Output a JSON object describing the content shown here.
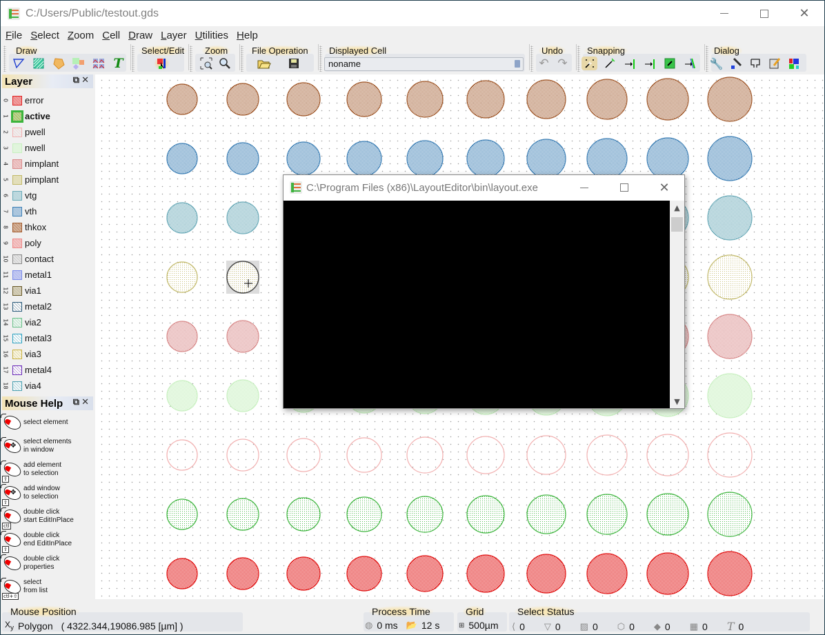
{
  "window": {
    "title": "C:/Users/Public/testout.gds",
    "controls": {
      "minimize": "minimize",
      "maximize": "maximize",
      "close": "close"
    }
  },
  "menu": [
    {
      "label": "File",
      "accel": "F",
      "rest": "ile"
    },
    {
      "label": "Select",
      "accel": "S",
      "rest": "elect"
    },
    {
      "label": "Zoom",
      "accel": "Z",
      "rest": "oom"
    },
    {
      "label": "Cell",
      "accel": "C",
      "rest": "ell"
    },
    {
      "label": "Draw",
      "accel": "D",
      "rest": "raw"
    },
    {
      "label": "Layer",
      "accel": "L",
      "rest": "ayer"
    },
    {
      "label": "Utilities",
      "accel": "U",
      "rest": "tilities"
    },
    {
      "label": "Help",
      "accel": "H",
      "rest": "elp"
    }
  ],
  "toolbar": {
    "draw": {
      "label": "Draw",
      "icons": [
        "draw-path-icon",
        "draw-box-icon",
        "draw-polygon-icon",
        "draw-boolean-icon",
        "draw-cell-array-icon",
        "draw-text-icon"
      ]
    },
    "select_edit": {
      "label": "Select/Edit",
      "icons": [
        "select-edit-icon"
      ]
    },
    "zoom": {
      "label": "Zoom",
      "icons": [
        "zoom-fit-icon",
        "zoom-magnifier-icon"
      ]
    },
    "file_operation": {
      "label": "File Operation",
      "icons": [
        "open-folder-icon",
        "save-disk-icon"
      ]
    },
    "displayed_cell": {
      "label": "Displayed Cell",
      "value": "noname"
    },
    "undo": {
      "label": "Undo",
      "icons": [
        "undo-icon",
        "redo-icon"
      ]
    },
    "snapping": {
      "label": "Snapping",
      "icons": [
        "snap-grid-icon",
        "snap-point-icon",
        "snap-edge-icon",
        "snap-middle-icon",
        "snap-element-icon",
        "snap-angle-icon"
      ]
    },
    "dialog": {
      "label": "Dialog",
      "icons": [
        "setup-icon",
        "macro-setup-icon",
        "schematic-icon",
        "properties-note-icon",
        "layer-colors-icon"
      ]
    }
  },
  "layer_panel": {
    "title": "Layer",
    "layers": [
      {
        "num": "0",
        "name": "error",
        "color": "#e02020",
        "fill": "#f08a8a",
        "active": false
      },
      {
        "num": "1",
        "name": "active",
        "color": "#3cb43c",
        "fill": "#b6c46a",
        "active": true
      },
      {
        "num": "2",
        "name": "pwell",
        "color": "#f2b0b0",
        "fill": "#eeeeee",
        "active": false
      },
      {
        "num": "3",
        "name": "nwell",
        "color": "#c8f0c0",
        "fill": "#dff7da",
        "active": false
      },
      {
        "num": "4",
        "name": "nimplant",
        "color": "#d88a8a",
        "fill": "#edb8b8",
        "active": false
      },
      {
        "num": "5",
        "name": "pimplant",
        "color": "#c2b96a",
        "fill": "#e4dfb4",
        "active": false
      },
      {
        "num": "6",
        "name": "vtg",
        "color": "#6aaab8",
        "fill": "#b9d8de",
        "active": false
      },
      {
        "num": "7",
        "name": "vth",
        "color": "#3d7fb5",
        "fill": "#a7c4de",
        "active": false
      },
      {
        "num": "8",
        "name": "thkox",
        "color": "#a0582a",
        "fill": "#c99a78",
        "active": false
      },
      {
        "num": "9",
        "name": "poly",
        "color": "#ee8888",
        "fill": "#f2b4b4",
        "active": false
      },
      {
        "num": "10",
        "name": "contact",
        "color": "#8a8a8a",
        "fill": "#e6e6e6",
        "active": false
      },
      {
        "num": "11",
        "name": "metal1",
        "color": "#7a8ae8",
        "fill": "#b7bff2",
        "active": false
      },
      {
        "num": "12",
        "name": "via1",
        "color": "#6a5a2a",
        "fill": "#d6cfb4",
        "active": false
      },
      {
        "num": "13",
        "name": "metal2",
        "color": "#2a5a7a",
        "fill": "#ffffff",
        "active": false
      },
      {
        "num": "14",
        "name": "via2",
        "color": "#6ac08a",
        "fill": "#e8f6ee",
        "active": false
      },
      {
        "num": "15",
        "name": "metal3",
        "color": "#2aa0c0",
        "fill": "#ffffff",
        "active": false
      },
      {
        "num": "16",
        "name": "via3",
        "color": "#c8b040",
        "fill": "#faf6e0",
        "active": false
      },
      {
        "num": "17",
        "name": "metal4",
        "color": "#6a2ab8",
        "fill": "#ffffff",
        "active": false
      },
      {
        "num": "18",
        "name": "via4",
        "color": "#4aa0b0",
        "fill": "#f2fafc",
        "active": false
      }
    ]
  },
  "mouse_help": {
    "title": "Mouse Help",
    "items": [
      {
        "line1": "select element",
        "line2": "",
        "move": false,
        "key": ""
      },
      {
        "line1": "select elements",
        "line2": "in window",
        "move": true,
        "key": ""
      },
      {
        "line1": "add element",
        "line2": "to selection",
        "move": false,
        "key": "⇧"
      },
      {
        "line1": "add window",
        "line2": "to selection",
        "move": true,
        "key": "⇧"
      },
      {
        "line1": "double click",
        "line2": "start EditInPlace",
        "move": false,
        "key": "ctl"
      },
      {
        "line1": "double click",
        "line2": "end EditInPlace",
        "move": false,
        "key": "⇧"
      },
      {
        "line1": "double click",
        "line2": "properties",
        "move": false,
        "key": ""
      },
      {
        "line1": "select",
        "line2": "from list",
        "move": false,
        "key": "ctl+⇧"
      }
    ]
  },
  "canvas": {
    "columns": 10,
    "rows": [
      {
        "layer": "thkox",
        "stroke": "#a0582a",
        "fill": "#b8845c",
        "opacity": 0.85,
        "pattern": "dense"
      },
      {
        "layer": "vth",
        "stroke": "#3d7fb5",
        "fill": "#8fb5d8",
        "opacity": 0.9,
        "pattern": "grid"
      },
      {
        "layer": "vtg",
        "stroke": "#6aaab8",
        "fill": "#a8d0d8",
        "opacity": 0.9,
        "pattern": "dense"
      },
      {
        "layer": "pimplant",
        "stroke": "#c2b96a",
        "fill": "#e2dca8",
        "opacity": 0.9,
        "pattern": "dots"
      },
      {
        "layer": "nimplant",
        "stroke": "#d88a8a",
        "fill": "#e4b0b0",
        "opacity": 0.9,
        "pattern": "dense"
      },
      {
        "layer": "nwell",
        "stroke": "#c8f0c0",
        "fill": "#d4f2cc",
        "opacity": 1,
        "pattern": "dense"
      },
      {
        "layer": "pwell",
        "stroke": "#f2b0b0",
        "fill": "none",
        "opacity": 1,
        "pattern": "none"
      },
      {
        "layer": "active",
        "stroke": "#3cb43c",
        "fill": "#9ed89e",
        "opacity": 0.9,
        "pattern": "dots"
      },
      {
        "layer": "error",
        "stroke": "#e01010",
        "fill": "#ec7070",
        "opacity": 0.95,
        "pattern": "grid"
      }
    ],
    "selected": {
      "row": 3,
      "col": 1,
      "stroke": "#444444",
      "fill": "#c9c89a"
    }
  },
  "console": {
    "title": "C:\\Program Files (x86)\\LayoutEditor\\bin\\layout.exe"
  },
  "status": {
    "mouse_position": {
      "label": "Mouse Position",
      "mode": "Polygon",
      "coords": "( 4322.344,19086.985 [µm] )"
    },
    "process_time": {
      "label": "Process Time",
      "calc": "0 ms",
      "load": "12 s"
    },
    "grid": {
      "label": "Grid",
      "value": "500µm"
    },
    "select_status": {
      "label": "Select Status",
      "items": [
        {
          "icon": "select-point-icon",
          "glyph": "⟨",
          "value": "0"
        },
        {
          "icon": "path-icon",
          "glyph": "▽",
          "value": "0"
        },
        {
          "icon": "box-icon",
          "glyph": "▨",
          "value": "0"
        },
        {
          "icon": "polygon-icon",
          "glyph": "⬡",
          "value": "0"
        },
        {
          "icon": "cell-ref-icon",
          "glyph": "◆",
          "value": "0"
        },
        {
          "icon": "cell-array-icon",
          "glyph": "▦",
          "value": "0"
        },
        {
          "icon": "text-icon",
          "glyph": "T",
          "value": "0"
        }
      ]
    }
  }
}
